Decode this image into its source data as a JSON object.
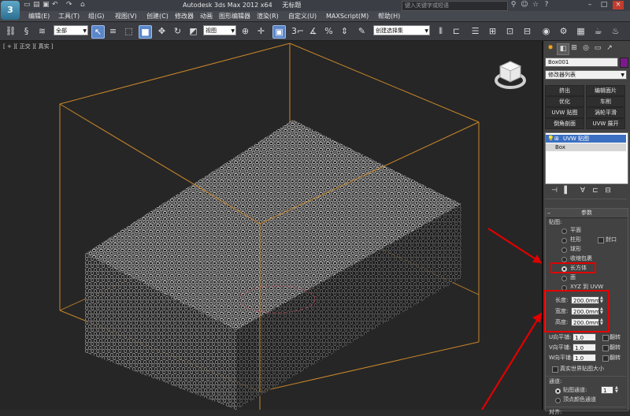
{
  "title": {
    "app": "Autodesk 3ds Max  2012 x64",
    "file": "无标题"
  },
  "search": {
    "placeholder": "键入关键字或短语"
  },
  "menu": [
    "编辑(E)",
    "工具(T)",
    "组(G)",
    "视图(V)",
    "创建(C)",
    "修改器",
    "动画",
    "图形编辑器",
    "渲染(R)",
    "自定义(U)",
    "MAXScript(M)",
    "帮助(H)"
  ],
  "toolbar": {
    "filter": "全部",
    "refcoord": "视图",
    "selection_set": "创建选择集",
    "snap_label": "3"
  },
  "viewport": {
    "label": "[ + ][ 正交 ][ 真实 ]"
  },
  "panel": {
    "object_name": "Box001",
    "object_color": "#7a1a8a",
    "modifier_list": "修改器列表",
    "mod_buttons": [
      "挤出",
      "编辑面片",
      "优化",
      "车削",
      "UVW 贴图",
      "涡轮平滑",
      "倒角剖面",
      "UVW 展开"
    ],
    "stack": [
      "UVW 贴图",
      "Box"
    ],
    "params": {
      "title": "参数",
      "map_label": "贴图:",
      "options": [
        "平面",
        "柱形",
        "封口",
        "球形",
        "收缩包裹",
        "长方体",
        "面",
        "XYZ 到 UVW"
      ],
      "selected_option": "长方体",
      "length_label": "长度:",
      "length": "200.0mm",
      "width_label": "宽度:",
      "width": "200.0mm",
      "height_label": "高度:",
      "height": "200.0mm",
      "u_tile_label": "U向平铺:",
      "u_tile": "1.0",
      "v_tile_label": "V向平铺:",
      "v_tile": "1.0",
      "w_tile_label": "W向平铺:",
      "w_tile": "1.0",
      "flip_label": "翻转",
      "real_world": "真实世界贴图大小",
      "channel_title": "通道:",
      "map_channel_label": "贴图通道:",
      "map_channel": "1",
      "vertex_color_label": "顶点颜色通道",
      "align_title": "对齐:"
    }
  },
  "annotation_color": "#e10000"
}
